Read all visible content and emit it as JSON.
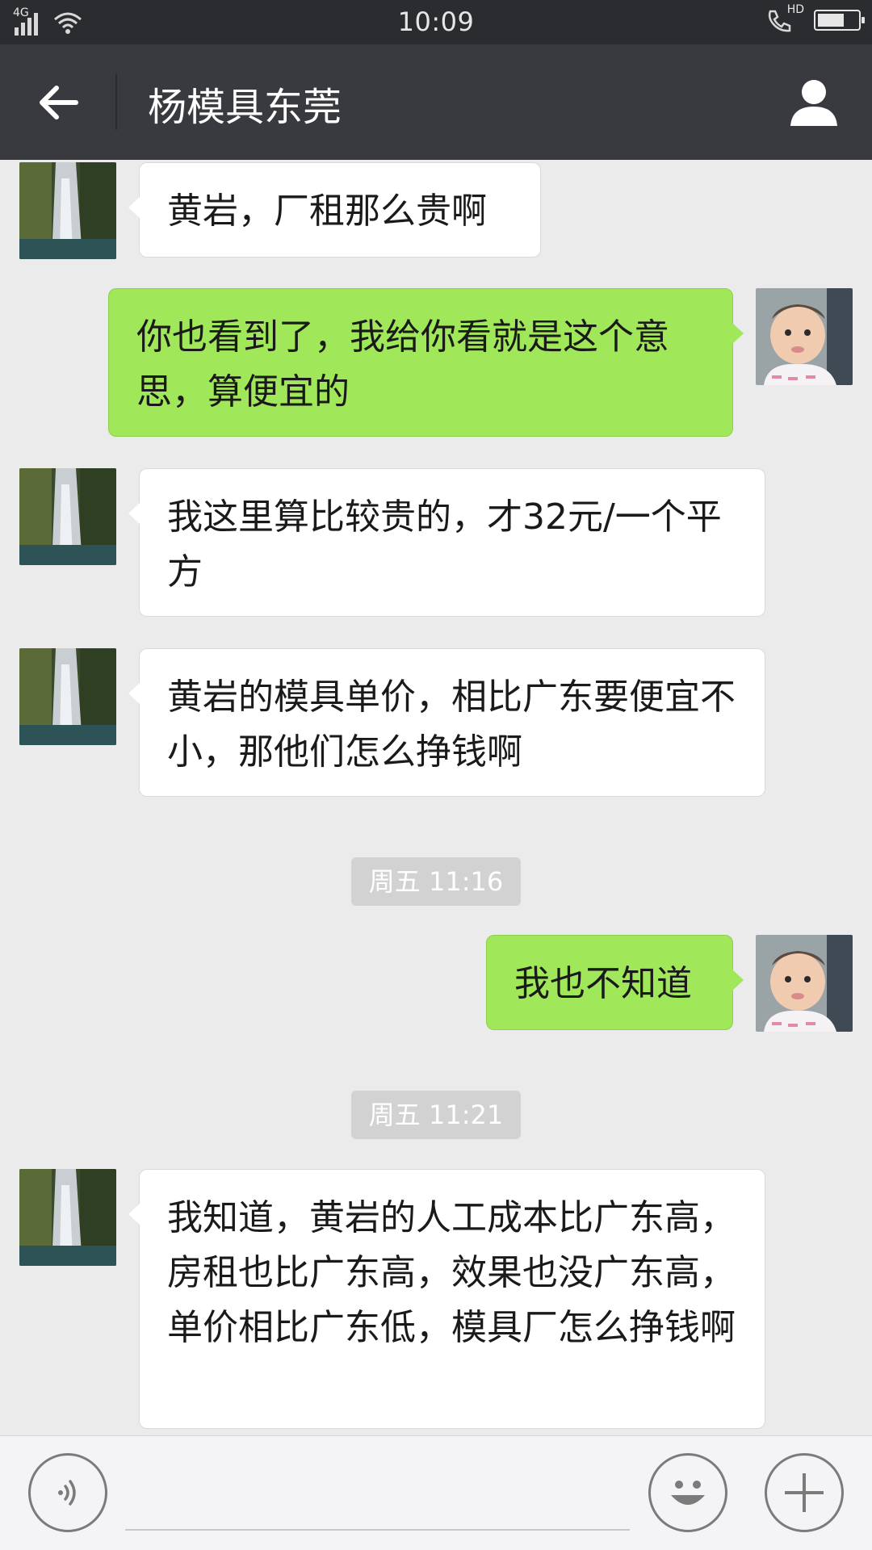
{
  "status_bar": {
    "network": "4G",
    "time": "10:09",
    "call_label": "HD",
    "battery_level": 0.7
  },
  "header": {
    "title": "杨模具东莞"
  },
  "messages": [
    {
      "side": "in",
      "text": "黄岩，厂租那么贵啊"
    },
    {
      "side": "out",
      "text": "你也看到了，我给你看就是这个意思，算便宜的"
    },
    {
      "side": "in",
      "text": "我这里算比较贵的，才32元/一个平方"
    },
    {
      "side": "in",
      "text": "黄岩的模具单价，相比广东要便宜不小，那他们怎么挣钱啊"
    },
    {
      "side": "out",
      "text": "我也不知道"
    },
    {
      "side": "in",
      "text": "我知道，黄岩的人工成本比广东高，房租也比广东高，效果也没广东高，单价相比广东低，模具厂怎么挣钱啊"
    }
  ],
  "timestamps": [
    "周五 11:16",
    "周五 11:21"
  ],
  "icons": {
    "back": "arrow-left-icon",
    "contact": "person-icon",
    "voice": "voice-icon",
    "emoji": "emoji-icon",
    "plus": "plus-icon"
  },
  "colors": {
    "nav_bg": "#393a3f",
    "status_bg": "#2b2c2f",
    "chat_bg": "#ebebeb",
    "bubble_out": "#a0e75a",
    "bubble_in": "#ffffff",
    "timestamp_bg": "#d2d2d2"
  }
}
